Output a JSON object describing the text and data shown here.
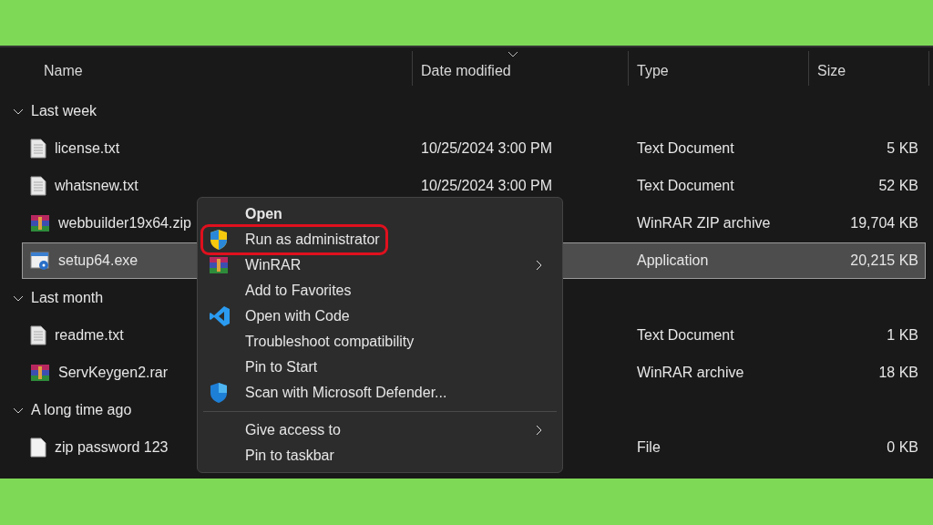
{
  "columns": [
    {
      "label": "Name",
      "sorted": false
    },
    {
      "label": "Date modified",
      "sorted": true
    },
    {
      "label": "Type",
      "sorted": false
    },
    {
      "label": "Size",
      "sorted": false
    }
  ],
  "groups": [
    {
      "label": "Last week",
      "expanded": true,
      "files": [
        {
          "name": "license.txt",
          "kind": "text",
          "date": "10/25/2024 3:00 PM",
          "type": "Text Document",
          "size": "5 KB",
          "selected": false
        },
        {
          "name": "whatsnew.txt",
          "kind": "text",
          "date": "10/25/2024 3:00 PM",
          "type": "Text Document",
          "size": "52 KB",
          "selected": false
        },
        {
          "name": "webbuilder19x64.zip",
          "kind": "archive",
          "type": "WinRAR ZIP archive",
          "size": "19,704 KB",
          "selected": false
        },
        {
          "name": "setup64.exe",
          "kind": "exe",
          "type": "Application",
          "size": "20,215 KB",
          "selected": true
        }
      ]
    },
    {
      "label": "Last month",
      "expanded": true,
      "files": [
        {
          "name": "readme.txt",
          "kind": "text",
          "type": "Text Document",
          "size": "1 KB",
          "selected": false
        },
        {
          "name": "ServKeygen2.rar",
          "kind": "archive",
          "type": "WinRAR archive",
          "size": "18 KB",
          "selected": false
        }
      ]
    },
    {
      "label": "A long time ago",
      "expanded": true,
      "files": [
        {
          "name": "zip password 123",
          "kind": "file",
          "type": "File",
          "size": "0 KB",
          "selected": false
        }
      ]
    }
  ],
  "context_menu": {
    "items": [
      {
        "label": "Open",
        "kind": "none",
        "bold": true,
        "submenu": false,
        "highlighted": false,
        "separator_before": false
      },
      {
        "label": "Run as administrator",
        "kind": "shield",
        "bold": false,
        "submenu": false,
        "highlighted": true,
        "separator_before": false
      },
      {
        "label": "WinRAR",
        "kind": "archive",
        "bold": false,
        "submenu": true,
        "highlighted": false,
        "separator_before": false
      },
      {
        "label": "Add to Favorites",
        "kind": "none",
        "bold": false,
        "submenu": false,
        "highlighted": false,
        "separator_before": false
      },
      {
        "label": "Open with Code",
        "kind": "code",
        "bold": false,
        "submenu": false,
        "highlighted": false,
        "separator_before": false
      },
      {
        "label": "Troubleshoot compatibility",
        "kind": "none",
        "bold": false,
        "submenu": false,
        "highlighted": false,
        "separator_before": false
      },
      {
        "label": "Pin to Start",
        "kind": "none",
        "bold": false,
        "submenu": false,
        "highlighted": false,
        "separator_before": false
      },
      {
        "label": "Scan with Microsoft Defender...",
        "kind": "defender",
        "bold": false,
        "submenu": false,
        "highlighted": false,
        "separator_before": false
      },
      {
        "label": "Give access to",
        "kind": "none",
        "bold": false,
        "submenu": true,
        "highlighted": false,
        "separator_before": true
      },
      {
        "label": "Pin to taskbar",
        "kind": "none",
        "bold": false,
        "submenu": false,
        "highlighted": false,
        "separator_before": false
      }
    ]
  }
}
